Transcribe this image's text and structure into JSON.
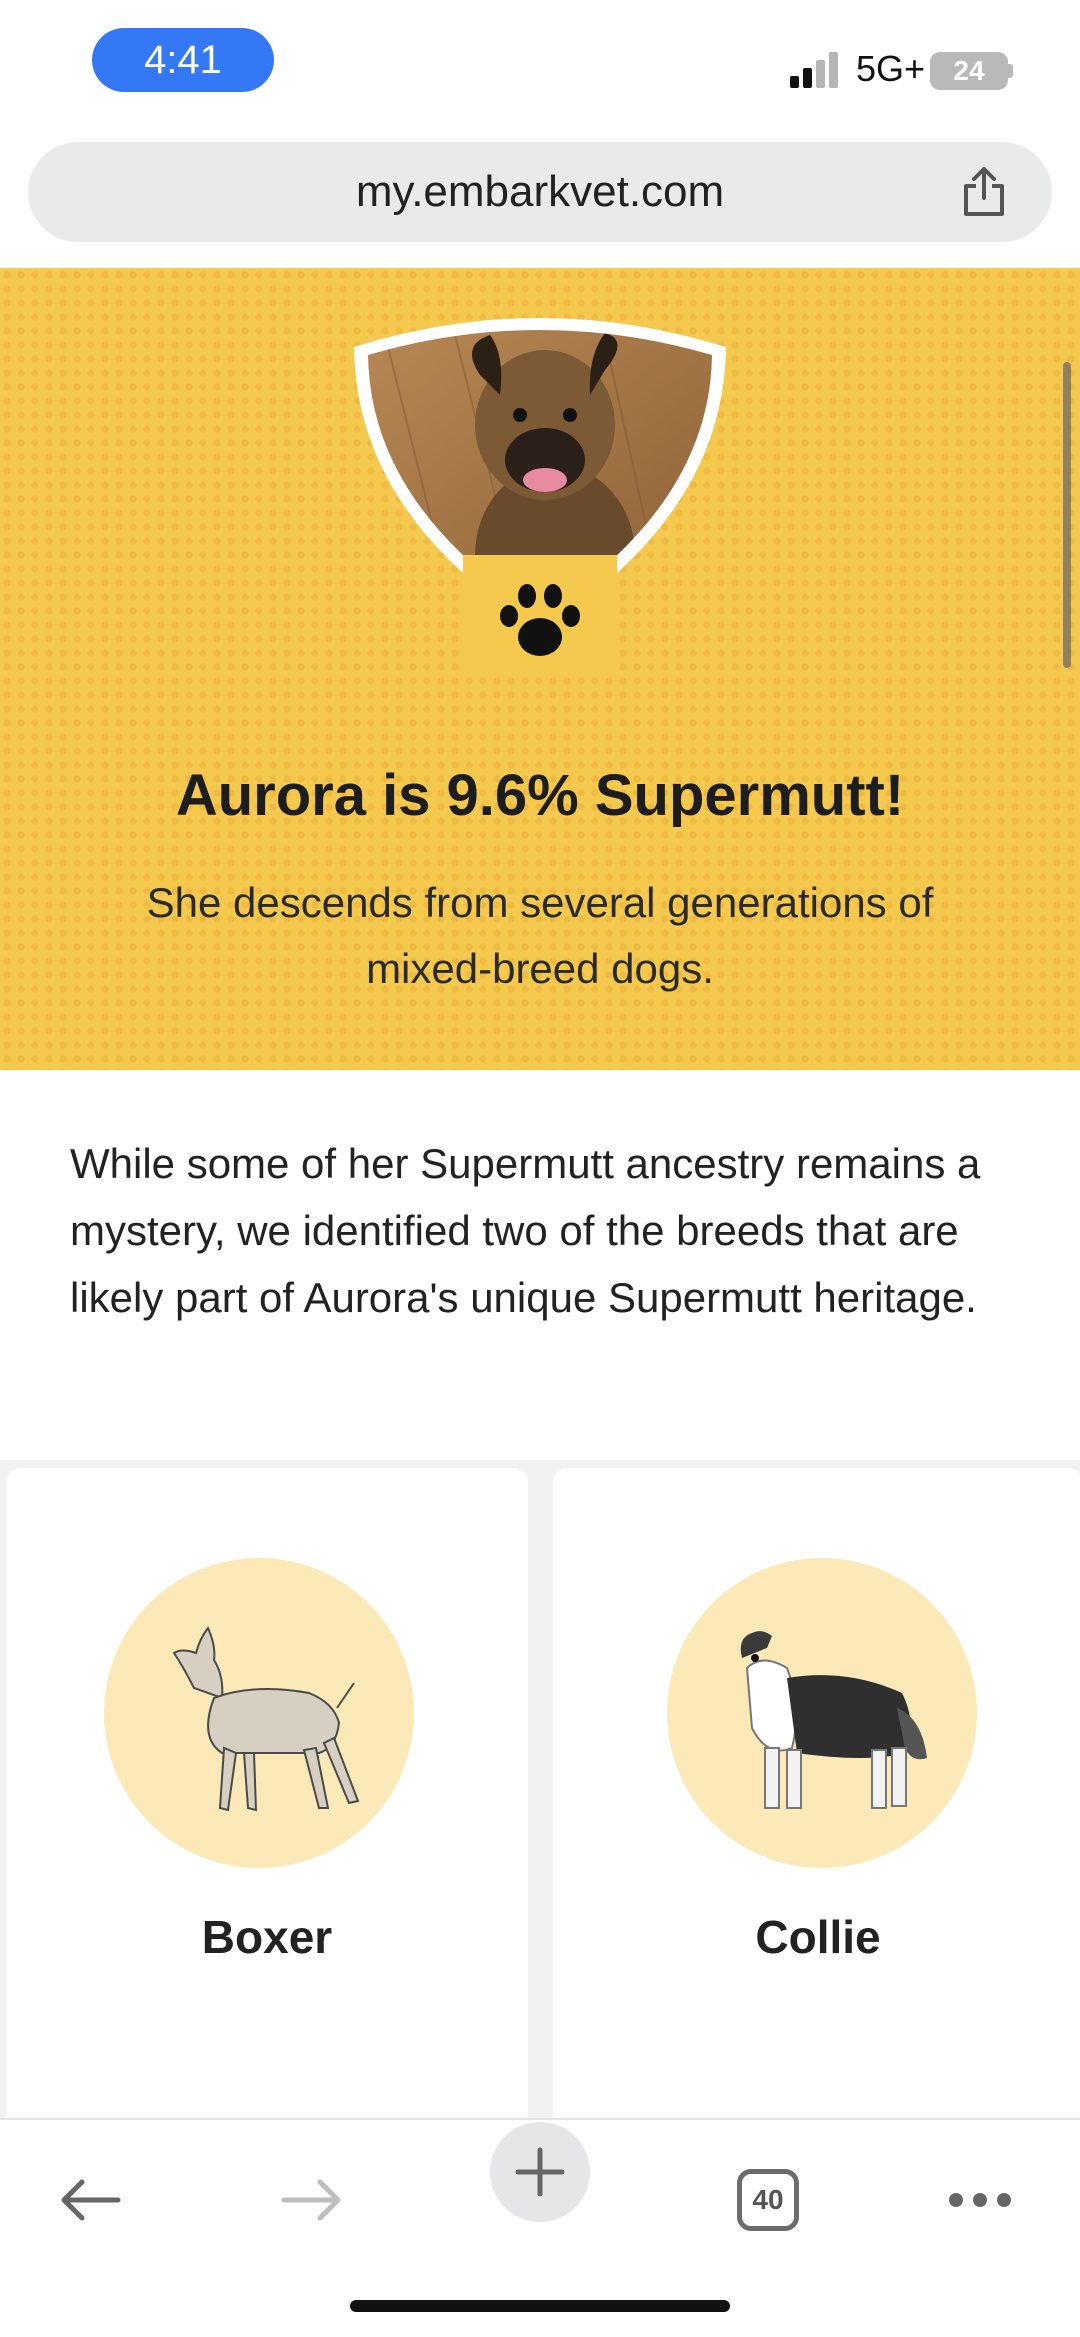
{
  "status_bar": {
    "time": "4:41",
    "network": "5G+",
    "battery": "24"
  },
  "browser": {
    "url": "my.embarkvet.com",
    "tab_count": "40"
  },
  "hero": {
    "title": "Aurora is 9.6% Supermutt!",
    "subtitle": "She descends from several generations of mixed-breed dogs."
  },
  "description": "While some of her Supermutt ancestry remains a mystery, we identified two of the breeds that are likely part of Aurora's unique Supermutt heritage.",
  "breeds": [
    {
      "name": "Boxer"
    },
    {
      "name": "Collie"
    }
  ],
  "colors": {
    "hero_yellow": "#f5c84e",
    "breed_circle": "#fbeab8",
    "time_pill": "#3478f6"
  },
  "icons": {
    "share": "share-icon",
    "paw": "paw-icon",
    "back": "back-arrow-icon",
    "forward": "forward-arrow-icon",
    "new_tab": "plus-icon",
    "more": "more-dots-icon"
  }
}
